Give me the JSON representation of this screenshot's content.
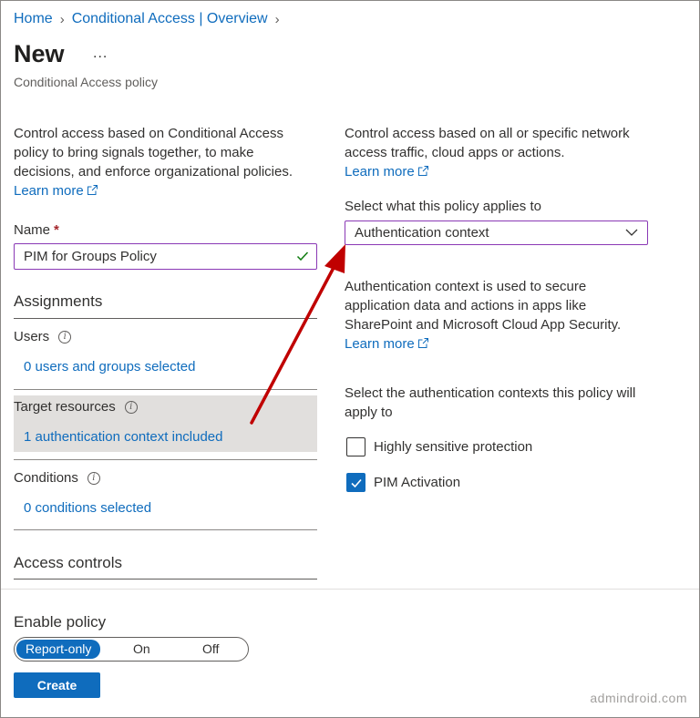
{
  "breadcrumb": {
    "home": "Home",
    "overview": "Conditional Access | Overview"
  },
  "header": {
    "title": "New",
    "more": "...",
    "subtitle": "Conditional Access policy"
  },
  "left": {
    "description": "Control access based on Conditional Access policy to bring signals together, to make decisions, and enforce organizational policies.",
    "learn_more": "Learn more",
    "name_label": "Name",
    "required_marker": "*",
    "name_value": "PIM for Groups Policy",
    "assignments_heading": "Assignments",
    "users_label": "Users",
    "users_link": "0 users and groups selected",
    "target_label": "Target resources",
    "target_link": "1 authentication context included",
    "conditions_label": "Conditions",
    "conditions_link": "0 conditions selected",
    "access_controls_heading": "Access controls"
  },
  "right": {
    "description": "Control access based on all or specific network access traffic, cloud apps or actions.",
    "learn_more": "Learn more",
    "applies_label": "Select what this policy applies to",
    "applies_value": "Authentication context",
    "auth_description": "Authentication context is used to secure application data and actions in apps like SharePoint and Microsoft Cloud App Security.",
    "auth_learn_more": "Learn more",
    "contexts_label": "Select the authentication contexts this policy will apply to",
    "contexts": [
      {
        "label": "Highly sensitive protection",
        "checked": false
      },
      {
        "label": "PIM Activation",
        "checked": true
      }
    ]
  },
  "footer": {
    "enable_label": "Enable policy",
    "toggle_options": [
      "Report-only",
      "On",
      "Off"
    ],
    "toggle_selected": "Report-only",
    "create_label": "Create"
  },
  "watermark": "admindroid.com",
  "colors": {
    "accent": "#0f6cbd",
    "focus_border": "#8a38b5",
    "arrow": "#c00000",
    "highlight_bg": "#e1dfdd"
  },
  "icons": [
    "chevron-right-icon",
    "external-link-icon",
    "checkmark-icon",
    "info-icon",
    "chevron-down-icon",
    "red-arrow-annotation"
  ]
}
